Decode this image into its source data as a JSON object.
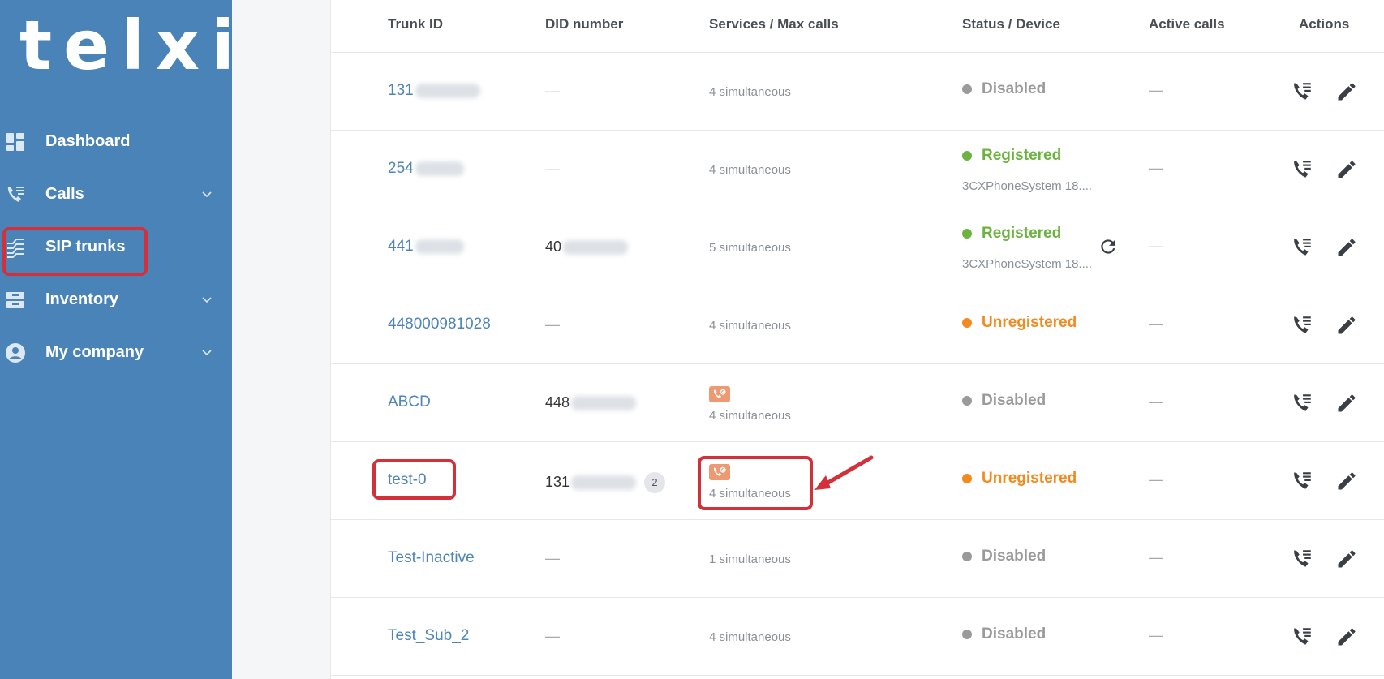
{
  "app": {
    "logo": "telxi"
  },
  "sidebar": {
    "items": [
      {
        "label": "Dashboard",
        "icon": "dashboard-icon",
        "has_chevron": false
      },
      {
        "label": "Calls",
        "icon": "calls-icon",
        "has_chevron": true
      },
      {
        "label": "SIP trunks",
        "icon": "sip-trunks-icon",
        "has_chevron": false,
        "active": true
      },
      {
        "label": "Inventory",
        "icon": "inventory-icon",
        "has_chevron": true
      },
      {
        "label": "My company",
        "icon": "company-icon",
        "has_chevron": true
      }
    ]
  },
  "table": {
    "columns": [
      "Trunk ID",
      "DID number",
      "Services / Max calls",
      "Status / Device",
      "Active calls",
      "Actions"
    ],
    "rows": [
      {
        "trunk_id": "131",
        "did": "—",
        "services": "4 simultaneous",
        "status": "Disabled",
        "device": "",
        "active_calls": "—"
      },
      {
        "trunk_id": "254",
        "did": "—",
        "services": "4 simultaneous",
        "status": "Registered",
        "device": "3CXPhoneSystem 18....",
        "active_calls": "—"
      },
      {
        "trunk_id": "441",
        "did": "40",
        "services": "5 simultaneous",
        "status": "Registered",
        "device": "3CXPhoneSystem 18....",
        "active_calls": "—"
      },
      {
        "trunk_id": "448000981028",
        "did": "—",
        "services": "4 simultaneous",
        "status": "Unregistered",
        "device": "",
        "active_calls": "—"
      },
      {
        "trunk_id": "ABCD",
        "did": "448",
        "services": "4 simultaneous",
        "status": "Disabled",
        "device": "",
        "active_calls": "—"
      },
      {
        "trunk_id": "test-0",
        "did": "131",
        "did_badge": "2",
        "services": "4 simultaneous",
        "status": "Unregistered",
        "device": "",
        "active_calls": "—"
      },
      {
        "trunk_id": "Test-Inactive",
        "did": "—",
        "services": "1 simultaneous",
        "status": "Disabled",
        "device": "",
        "active_calls": "—"
      },
      {
        "trunk_id": "Test_Sub_2",
        "did": "—",
        "services": "4 simultaneous",
        "status": "Disabled",
        "device": "",
        "active_calls": "—"
      }
    ]
  },
  "colors": {
    "sidebar_bg": "#4a83b7",
    "link": "#4e84b7",
    "disabled": "#9a9a9a",
    "registered": "#6cb33f",
    "unregistered": "#f28a1e",
    "annotation": "#d3303a",
    "service_icon": "#ed9a72"
  }
}
